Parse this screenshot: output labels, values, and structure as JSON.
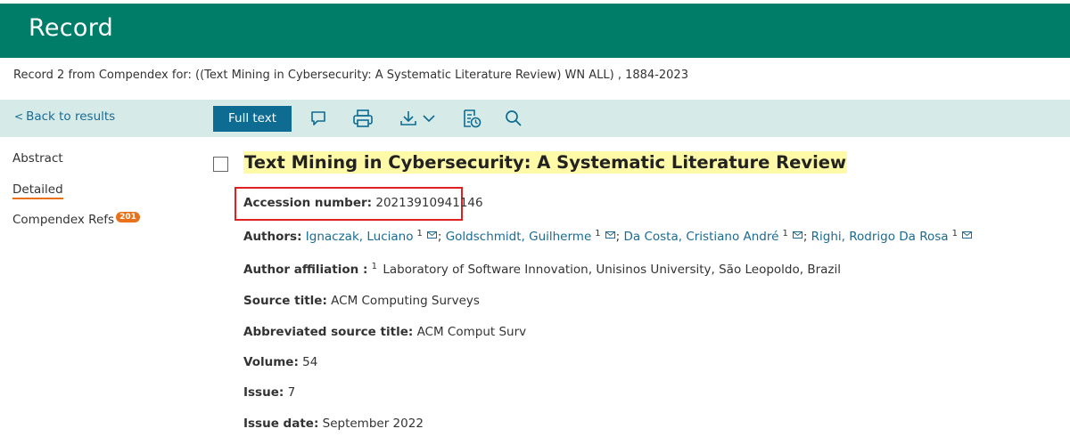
{
  "header": {
    "title": "Record"
  },
  "breadcrumb": {
    "text": "Record 2 from Compendex for: ((Text Mining in Cybersecurity: A Systematic Literature Review) WN ALL) , 1884-2023"
  },
  "toolbar": {
    "back_label": "Back to results",
    "full_text_label": "Full text",
    "icons": [
      "comment-icon",
      "print-icon",
      "download-icon",
      "chevron-down-icon",
      "history-icon",
      "search-icon"
    ]
  },
  "nav": {
    "items": [
      {
        "label": "Abstract"
      },
      {
        "label": "Detailed"
      },
      {
        "label": "Compendex Refs",
        "badge": "201"
      }
    ]
  },
  "record": {
    "title": "Text Mining in Cybersecurity: A Systematic Literature Review",
    "accession": {
      "label": "Accession number:",
      "value": "20213910941146"
    },
    "authors": {
      "label": "Authors:",
      "list": [
        {
          "name": "Ignaczak, Luciano",
          "sup": "1"
        },
        {
          "name": "Goldschmidt, Guilherme",
          "sup": "1"
        },
        {
          "name": "Da Costa, Cristiano André",
          "sup": "1"
        },
        {
          "name": "Righi, Rodrigo Da Rosa",
          "sup": "1"
        }
      ],
      "separator": ";"
    },
    "affiliation": {
      "label": "Author affiliation :",
      "sup": "1",
      "value": "Laboratory of Software Innovation, Unisinos University, São Leopoldo, Brazil"
    },
    "source_title": {
      "label": "Source title:",
      "value": "ACM Computing Surveys"
    },
    "abbrev_source": {
      "label": "Abbreviated source title:",
      "value": "ACM Comput Surv"
    },
    "volume": {
      "label": "Volume:",
      "value": "54"
    },
    "issue": {
      "label": "Issue:",
      "value": "7"
    },
    "issue_date": {
      "label": "Issue date:",
      "value": "September 2022"
    }
  },
  "colors": {
    "header_bg": "#007d68",
    "toolbar_bg": "#d6eae7",
    "button_bg": "#0e6c93",
    "link": "#1a6b93",
    "badge": "#e9711c",
    "title_highlight": "#fffaa8",
    "accession_outline": "#e02020"
  }
}
